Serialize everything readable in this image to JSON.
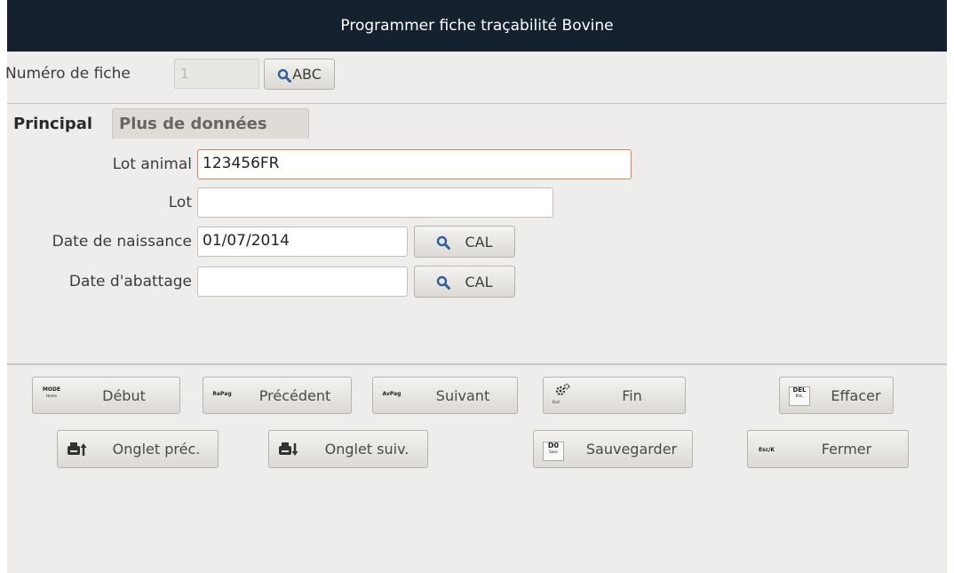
{
  "window": {
    "title": "Programmer fiche traçabilité Bovine"
  },
  "fiche": {
    "label": "Numéro de fiche",
    "value": "1",
    "abc_label": "ABC"
  },
  "tabs": [
    {
      "label": "Principal",
      "active": true
    },
    {
      "label": "Plus de données",
      "active": false
    }
  ],
  "form": {
    "lot_animal": {
      "label": "Lot animal",
      "value": "123456FR"
    },
    "lot": {
      "label": "Lot",
      "value": ""
    },
    "date_naissance": {
      "label": "Date de naissance",
      "value": "01/07/2014",
      "cal_label": "CAL"
    },
    "date_abattage": {
      "label": "Date d'abattage",
      "value": "",
      "cal_label": "CAL"
    }
  },
  "buttons": {
    "debut": {
      "label": "Début",
      "key": "MODE",
      "key_sub": "Home"
    },
    "precedent": {
      "label": "Précédent",
      "key": "RePag"
    },
    "suivant": {
      "label": "Suivant",
      "key": "AvPag"
    },
    "fin": {
      "label": "Fin",
      "key_sub": "End"
    },
    "effacer": {
      "label": "Effacer",
      "key": "DEL",
      "key_sub": "Ins."
    },
    "onglet_prec": {
      "label": "Onglet préc."
    },
    "onglet_suiv": {
      "label": "Onglet suiv."
    },
    "sauvegarder": {
      "label": "Sauvegarder",
      "key": "D0",
      "key_sub": "Save"
    },
    "fermer": {
      "label": "Fermer",
      "key": "Esc/K"
    }
  },
  "colors": {
    "titlebar": "#15212f",
    "window_bg": "#efedeb",
    "focus_border": "#d4875a",
    "search_icon": "#2e5e9c"
  },
  "icons": [
    "search-icon",
    "gear-icon",
    "printer-up-icon",
    "printer-down-icon"
  ]
}
